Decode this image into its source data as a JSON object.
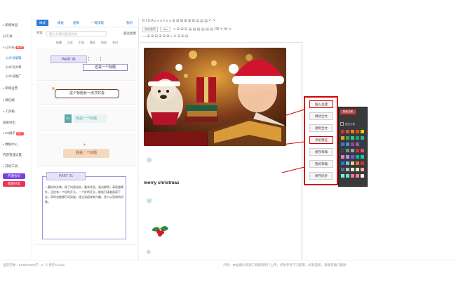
{
  "nav": {
    "items": [
      {
        "label": "新媒体园",
        "caret": "▸"
      },
      {
        "label": "分工具",
        "caret": ""
      },
      {
        "label": "公众号",
        "caret": "▾",
        "badge": "NEW"
      },
      {
        "label": "公众号编辑",
        "caret": ""
      },
      {
        "label": "公众号文章",
        "caret": ""
      },
      {
        "label": "公众号推广",
        "caret": ""
      },
      {
        "label": "新媒运营",
        "caret": "▸"
      },
      {
        "label": "微信端",
        "caret": "▸"
      },
      {
        "label": "工具箱",
        "caret": "▸"
      },
      {
        "label": "排版导出",
        "caret": ""
      },
      {
        "label": "H5展示",
        "caret": "▸",
        "badge": "热门"
      },
      {
        "label": "数据中心",
        "caret": "▸"
      },
      {
        "label": "内容管理设置",
        "caret": ""
      },
      {
        "label": "其他工具",
        "caret": "▸"
      }
    ],
    "btn1": "开通会员",
    "btn2": "邀请好友"
  },
  "panel": {
    "tabs": [
      "样式",
      "模板",
      "图库",
      "一键排版",
      "我的"
    ],
    "search_label": "搜索",
    "search_placeholder": "输入关键词搜索样式",
    "more_label": "最近使用",
    "subtabs": [
      "标题",
      "正文",
      "引导",
      "图文",
      "布局",
      "节日"
    ],
    "tpl1_title": "PART 01",
    "tpl1_sub": "这是一个标题",
    "tpl2_text": "这个标题长一点才好看",
    "tpl3_num": "01",
    "tpl3_text": "我是一个标题",
    "tpl4_text": "我是一个标题",
    "tpl5_title": "PART 01",
    "tpl5_body": "一篇好的文章，除了内容充实，要求作品、观点鲜明，表现感情外，还应有一个好的开头。一个好的开头，能吸引读者阅读下去，同时也能够打动读者，使之读起来有兴趣，给人以深刻的印象。"
  },
  "toolbar": {
    "row1": "B  I  U  A  ≡  ≡  ≡  ≡  ≡  ≡  ⊞  ⊞  ⊞  ⊞  ⊞  ⊞  ▤  ▤  ▤  ↶  ↷",
    "font": "微软雅黑",
    "size": "16px",
    "row2_rest": "≡  ⊞  ⊞  ⊞  ▤  ▤  ▤  ▤  ▤  ▤  ⌫  ✎  ⌘  ⊙",
    "row3": "—  ⊞  ⊞  ⊞  ⊞  ⊞  ⊞  ◐  ⊙  ⊞  ⊞  ⊞"
  },
  "editor": {
    "heading": "merry christmas"
  },
  "context_menu": {
    "items": [
      {
        "label": "插入主题"
      },
      {
        "label": "继续全文"
      },
      {
        "label": "复制全文"
      },
      {
        "label": "手机预览"
      },
      {
        "label": "保存草稿"
      },
      {
        "label": "我的草稿"
      },
      {
        "label": "保存同步"
      }
    ]
  },
  "palette": {
    "header": "配色方案",
    "custom_label": "配色方案",
    "colors": [
      "#c0392b",
      "#e74c3c",
      "#e67e22",
      "#d35400",
      "#f1c40f",
      "#f39c12",
      "#27ae60",
      "#2ecc71",
      "#16a085",
      "#1abc9c",
      "#2980b9",
      "#3498db",
      "#8e44ad",
      "#9b59b6",
      "#2c3e50",
      "#34495e",
      "#7f8c8d",
      "#95a5a6",
      "#c0392b",
      "#e84393",
      "#fd79a8",
      "#a29bfe",
      "#6c5ce7",
      "#00b894",
      "#00cec9",
      "#0984e3",
      "#74b9ff",
      "#fdcb6e",
      "#e17055",
      "#d63031",
      "#636e72",
      "#b2bec3",
      "#dfe6e9",
      "#ffeaa7",
      "#fab1a0",
      "#81ecec",
      "#55efc4",
      "#ff7675",
      "#fd79a8",
      "#ffffff"
    ]
  },
  "status": {
    "left": "当前字数：1438/20000字 · 0",
    "mid": "☐ 保存Cookie",
    "right": "声明：本站图片来源于网络和用户上传，仅供参考学习使用，如有侵权，请联系我们删除"
  }
}
